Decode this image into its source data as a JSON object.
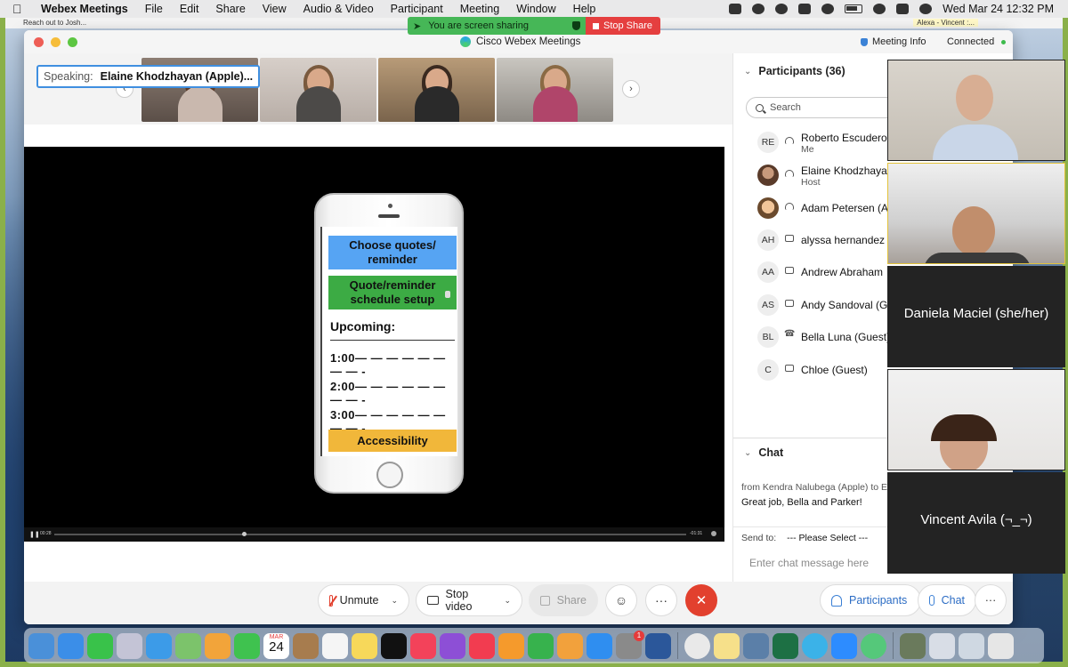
{
  "menubar": {
    "app_name": "Webex Meetings",
    "items": [
      "File",
      "Edit",
      "Share",
      "View",
      "Audio & Video",
      "Participant",
      "Meeting",
      "Window",
      "Help"
    ],
    "datetime": "Wed Mar 24  12:32 PM"
  },
  "subbar": {
    "left_note": "Reach out to Josh...",
    "right_note": "Alexa - Vincent :..."
  },
  "sharing_banner": {
    "message": "You are screen sharing",
    "stop_label": "Stop Share"
  },
  "window": {
    "title": "Cisco Webex Meetings",
    "meeting_info": "Meeting Info",
    "status": "Connected"
  },
  "speaking": {
    "label": "Speaking:",
    "name": "Elaine Khodzhayan (Apple)..."
  },
  "shared_screen": {
    "buttons": [
      "Choose quotes/ reminder",
      "Quote/reminder schedule setup",
      "Accessibility"
    ],
    "upcoming_label": "Upcoming:",
    "slots": [
      "1:00— — — — — — — — -",
      "2:00— — — — — — — — -",
      "3:00— — — — — — — — -"
    ],
    "player": {
      "elapsed": "00:28",
      "remaining": "-01:31"
    }
  },
  "participants": {
    "header": "Participants (36)",
    "search_placeholder": "Search",
    "list": [
      {
        "initials": "RE",
        "name": "Roberto Escudero",
        "role": "Me"
      },
      {
        "initials": "",
        "name": "Elaine Khodzhayan",
        "role": "Host"
      },
      {
        "initials": "",
        "name": "Adam Petersen (A",
        "role": ""
      },
      {
        "initials": "AH",
        "name": "alyssa hernandez",
        "role": ""
      },
      {
        "initials": "AA",
        "name": "Andrew Abraham",
        "role": ""
      },
      {
        "initials": "AS",
        "name": "Andy Sandoval (G",
        "role": ""
      },
      {
        "initials": "BL",
        "name": "Bella Luna (Guest)",
        "role": ""
      },
      {
        "initials": "C",
        "name": "Chloe (Guest)",
        "role": ""
      }
    ]
  },
  "chat": {
    "header": "Chat",
    "from": "from Kendra Nalubega (Apple) to E",
    "message": "Great job, Bella and Parker!",
    "send_to_label": "Send to:",
    "send_to_value": "--- Please Select ---",
    "input_placeholder": "Enter chat message here"
  },
  "video_tiles": [
    {
      "name": ""
    },
    {
      "name": ""
    },
    {
      "name": "Daniela Maciel  (she/her)"
    },
    {
      "name": ""
    },
    {
      "name": "Vincent Avila (¬_¬)"
    }
  ],
  "controls": {
    "unmute": "Unmute",
    "stop_video": "Stop video",
    "share": "Share",
    "participants": "Participants",
    "chat": "Chat",
    "more": "···",
    "end": "✕"
  },
  "dock": {
    "calendar_month": "MAR",
    "calendar_day": "24",
    "badge_count": "1"
  },
  "colors": {
    "accent_blue": "#3f8fe0",
    "share_green": "#46b757",
    "stop_red": "#e53f3f",
    "end_red": "#e2402e"
  }
}
